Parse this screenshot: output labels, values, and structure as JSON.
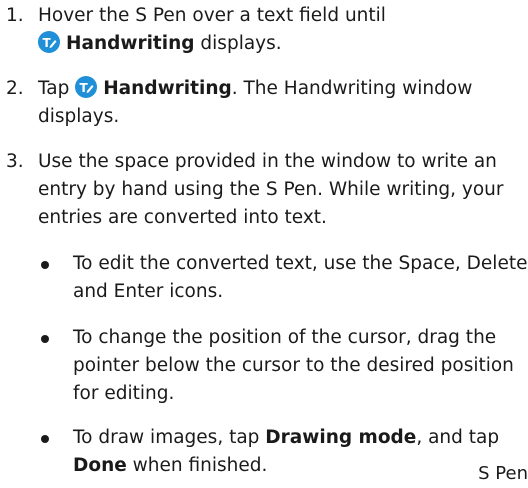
{
  "steps": [
    {
      "number": "1.",
      "line1": "Hover the S Pen over a text field until",
      "icon": "handwriting-icon",
      "keyword": "Handwriting",
      "after": " displays."
    },
    {
      "number": "2.",
      "before": "Tap ",
      "icon": "handwriting-icon",
      "keyword": "Handwriting",
      "after": ". The Handwriting window",
      "line2": "displays."
    },
    {
      "number": "3.",
      "line1": "Use the space provided in the window to write an",
      "line2": "entry by hand using the S Pen. While writing, your",
      "line3": "entries are converted into text."
    }
  ],
  "bullets": [
    {
      "line1": "To edit the converted text, use the Space, Delete,",
      "line2": "and Enter icons."
    },
    {
      "line1": "To change the position of the cursor, drag the",
      "line2": "pointer below the cursor to the desired position",
      "line3": "for editing."
    },
    {
      "line1_before": "To draw images, tap ",
      "line1_bold": "Drawing mode",
      "line1_after": ", and tap",
      "line2_bold": "Done",
      "line2_after": " when finished."
    }
  ],
  "footer": "S Pen",
  "colors": {
    "icon": "#1f8fd8",
    "text": "#1a1a1a"
  }
}
